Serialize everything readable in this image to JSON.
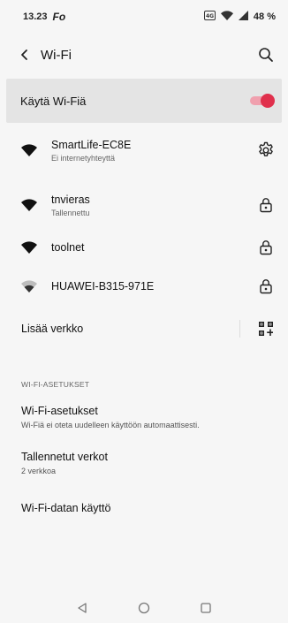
{
  "status_bar": {
    "time": "13.23",
    "app_indicator": "Fo",
    "battery": "48 %",
    "icons": [
      "lte-icon",
      "wifi-signal-icon",
      "cell-signal-icon"
    ]
  },
  "app_bar": {
    "title": "Wi-Fi",
    "back_icon": "chevron-left-icon",
    "search_icon": "search-icon"
  },
  "master_toggle": {
    "label": "Käytä Wi-Fiä",
    "on": true,
    "accent_color": "#e0304c"
  },
  "networks": [
    {
      "name": "SmartLife-EC8E",
      "subtitle": "Ei internetyhteyttä",
      "signal": "full",
      "action_icon": "gear-icon"
    },
    {
      "name": "tnvieras",
      "subtitle": "Tallennettu",
      "signal": "full",
      "action_icon": "lock-icon"
    },
    {
      "name": "toolnet",
      "subtitle": "",
      "signal": "full",
      "action_icon": "lock-icon"
    },
    {
      "name": "HUAWEI-B315-971E",
      "subtitle": "",
      "signal": "weak",
      "action_icon": "lock-icon"
    }
  ],
  "add_network": {
    "label": "Lisää verkko",
    "icon": "qr-add-icon"
  },
  "settings_section": {
    "header": "WI-FI-ASETUKSET",
    "items": [
      {
        "title": "Wi-Fi-asetukset",
        "subtitle": "Wi-Fiä ei oteta uudelleen käyttöön automaattisesti."
      },
      {
        "title": "Tallennetut verkot",
        "subtitle": "2 verkkoa"
      },
      {
        "title": "Wi-Fi-datan käyttö",
        "subtitle": ""
      }
    ]
  },
  "nav_bar": {
    "buttons": [
      "back-triangle-icon",
      "home-circle-icon",
      "recents-square-icon"
    ]
  }
}
